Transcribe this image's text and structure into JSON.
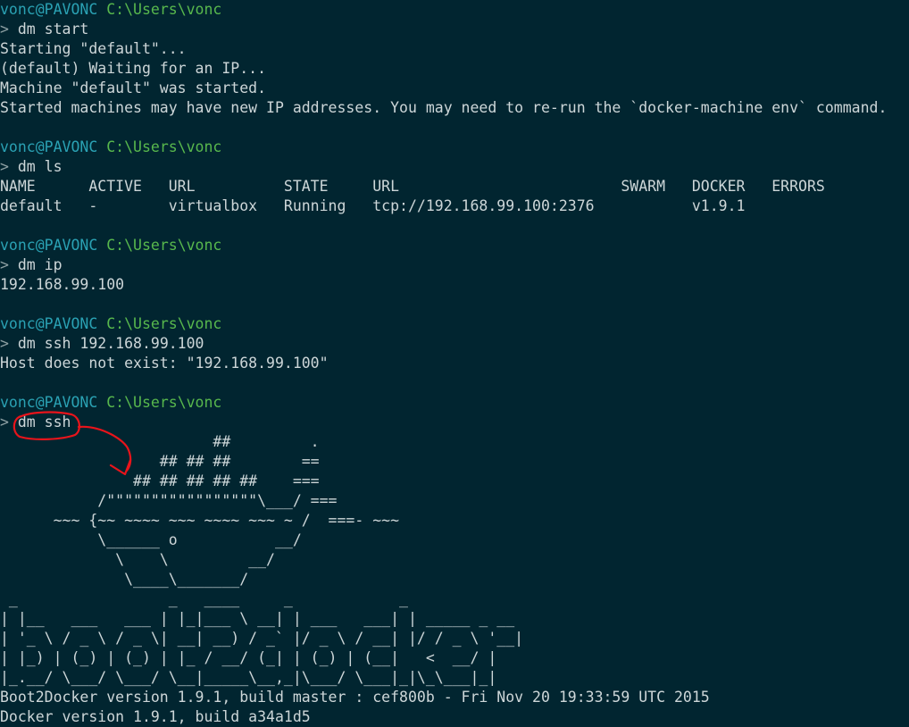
{
  "prompt": {
    "user": "vonc@PAVONC",
    "path": "C:\\Users\\vonc",
    "caret": ">"
  },
  "colors": {
    "background": "#012530",
    "text": "#cdd6d8",
    "user": "#2aa1b3",
    "path": "#58b84d",
    "annotation": "#e8141b"
  },
  "lines": [
    {
      "type": "prompt",
      "name": "prompt-line-1"
    },
    {
      "type": "cmd",
      "text": "dm start",
      "name": "command-dm-start"
    },
    {
      "type": "out",
      "text": "Starting \"default\"...",
      "name": "output-starting"
    },
    {
      "type": "out",
      "text": "(default) Waiting for an IP...",
      "name": "output-waiting-ip"
    },
    {
      "type": "out",
      "text": "Machine \"default\" was started.",
      "name": "output-machine-started"
    },
    {
      "type": "out",
      "text": "Started machines may have new IP addresses. You may need to re-run the `docker-machine env` command.",
      "name": "output-ip-warning"
    },
    {
      "type": "blank"
    },
    {
      "type": "prompt",
      "name": "prompt-line-2"
    },
    {
      "type": "cmd",
      "text": "dm ls",
      "name": "command-dm-ls"
    },
    {
      "type": "out",
      "text": "NAME      ACTIVE   URL          STATE     URL                         SWARM   DOCKER   ERRORS",
      "name": "ls-table-header"
    },
    {
      "type": "out",
      "text": "default   -        virtualbox   Running   tcp://192.168.99.100:2376           v1.9.1",
      "name": "ls-table-row"
    },
    {
      "type": "blank"
    },
    {
      "type": "prompt",
      "name": "prompt-line-3"
    },
    {
      "type": "cmd",
      "text": "dm ip",
      "name": "command-dm-ip"
    },
    {
      "type": "out",
      "text": "192.168.99.100",
      "name": "output-ip"
    },
    {
      "type": "blank"
    },
    {
      "type": "prompt",
      "name": "prompt-line-4"
    },
    {
      "type": "cmd",
      "text": "dm ssh 192.168.99.100",
      "name": "command-dm-ssh-ip"
    },
    {
      "type": "out",
      "text": "Host does not exist: \"192.168.99.100\"",
      "name": "output-host-error"
    },
    {
      "type": "blank"
    },
    {
      "type": "prompt",
      "name": "prompt-line-5"
    },
    {
      "type": "cmd",
      "text": "dm ssh",
      "name": "command-dm-ssh"
    },
    {
      "type": "out",
      "text": "                        ##         .",
      "name": "ascii-whale-line"
    },
    {
      "type": "out",
      "text": "                  ## ## ##        ==",
      "name": "ascii-whale-line"
    },
    {
      "type": "out",
      "text": "               ## ## ## ## ##    ===",
      "name": "ascii-whale-line"
    },
    {
      "type": "out",
      "text": "           /\"\"\"\"\"\"\"\"\"\"\"\"\"\"\"\"\"\\___/ ===",
      "name": "ascii-whale-line"
    },
    {
      "type": "out",
      "text": "      ~~~ {~~ ~~~~ ~~~ ~~~~ ~~~ ~ /  ===- ~~~",
      "name": "ascii-whale-line"
    },
    {
      "type": "out",
      "text": "           \\______ o           __/",
      "name": "ascii-whale-line"
    },
    {
      "type": "out",
      "text": "             \\    \\         __/",
      "name": "ascii-whale-line"
    },
    {
      "type": "out",
      "text": "              \\____\\_______/",
      "name": "ascii-whale-line"
    },
    {
      "type": "out",
      "text": " _                 _   ____     _            _",
      "name": "ascii-banner-line"
    },
    {
      "type": "out",
      "text": "| |__   ___   ___ | |_|___ \\ __| | ___   ___| | _____ _ __",
      "name": "ascii-banner-line"
    },
    {
      "type": "out",
      "text": "| '_ \\ / _ \\ / _ \\| __| __) / _` |/ _ \\ / __| |/ / _ \\ '__|",
      "name": "ascii-banner-line"
    },
    {
      "type": "out",
      "text": "| |_) | (_) | (_) | |_ / __/ (_| | (_) | (__|   <  __/ |",
      "name": "ascii-banner-line"
    },
    {
      "type": "out",
      "text": "|_.__/ \\___/ \\___/ \\__|_____\\__,_|\\___/ \\___|_|\\_\\___|_|",
      "name": "ascii-banner-line"
    },
    {
      "type": "out",
      "text": "Boot2Docker version 1.9.1, build master : cef800b - Fri Nov 20 19:33:59 UTC 2015",
      "name": "output-boot2docker-version"
    },
    {
      "type": "out",
      "text": "Docker version 1.9.1, build a34a1d5",
      "name": "output-docker-version"
    }
  ]
}
